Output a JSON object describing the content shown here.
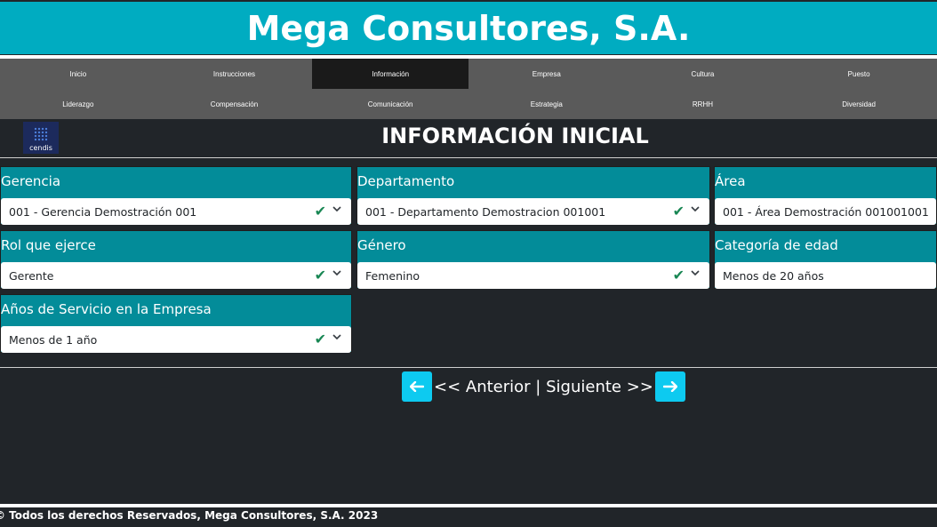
{
  "header": {
    "title": "Mega Consultores, S.A."
  },
  "nav": {
    "row1": [
      "Inicio",
      "Instrucciones",
      "Información",
      "Empresa",
      "Cultura",
      "Puesto"
    ],
    "row2": [
      "Liderazgo",
      "Compensación",
      "Comunicación",
      "Estrategia",
      "RRHH",
      "Diversidad"
    ],
    "active": "Información"
  },
  "logo": {
    "text": "cendis"
  },
  "page": {
    "title": "INFORMACIÓN INICIAL"
  },
  "fields": {
    "gerencia": {
      "label": "Gerencia",
      "value": "001 - Gerencia Demostración 001",
      "valid": true
    },
    "departamento": {
      "label": "Departamento",
      "value": "001 - Departamento Demostracion 001001",
      "valid": true
    },
    "area": {
      "label": "Área",
      "value": "001 - Área Demostración 001001001",
      "valid": true
    },
    "rol": {
      "label": "Rol que ejerce",
      "value": "Gerente",
      "valid": true
    },
    "genero": {
      "label": "Género",
      "value": "Femenino",
      "valid": true
    },
    "edad": {
      "label": "Categoría de edad",
      "value": "Menos de 20 años",
      "valid": true
    },
    "anios": {
      "label": "Años de Servicio en la Empresa",
      "value": "Menos de 1 año",
      "valid": true
    }
  },
  "pager": {
    "prev_label": "<< Anterior",
    "divider": "|",
    "next_label": "Siguiente >>"
  },
  "colors": {
    "header": "#00acc1",
    "card": "#038c99",
    "nav": "#5a5a5a",
    "nav_active": "#1a1a1a",
    "background": "#212529",
    "pager_button": "#0dcaf0",
    "check": "#198754"
  },
  "footer": {
    "text": "© Todos los derechos Reservados, Mega Consultores, S.A. 2023"
  }
}
